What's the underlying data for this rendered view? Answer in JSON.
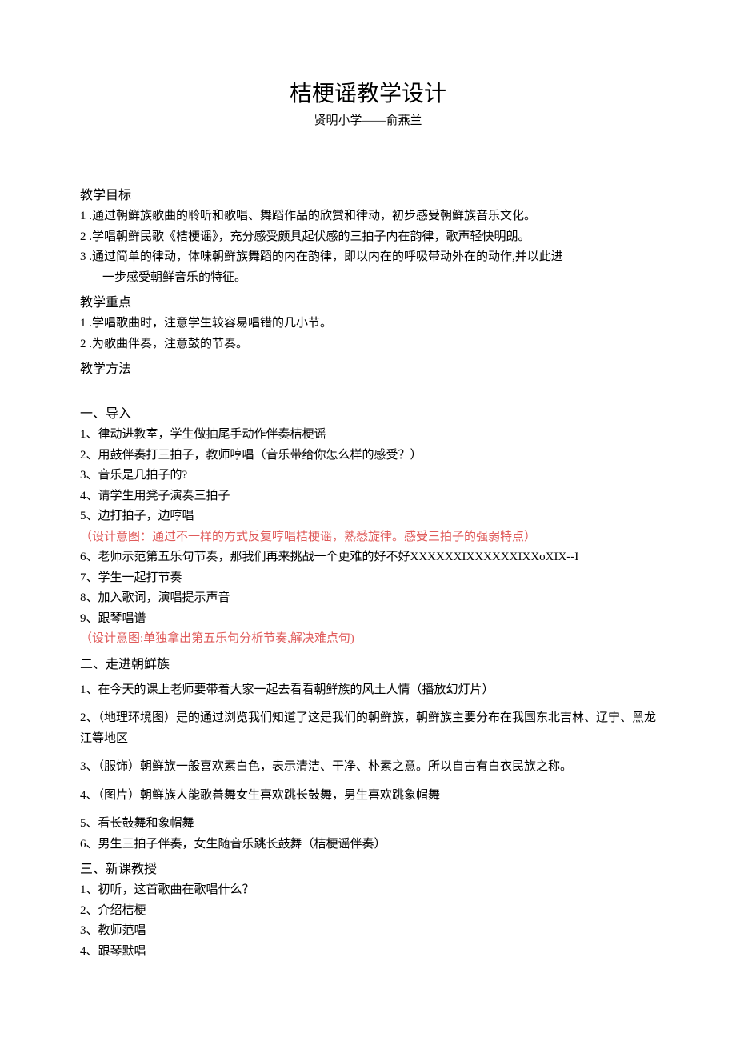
{
  "title": "桔梗谣教学设计",
  "subtitle": "贤明小学——俞燕兰",
  "sections": {
    "goals": {
      "head": "教学目标",
      "items": [
        "1 .通过朝鲜族歌曲的聆听和歌唱、舞蹈作品的欣赏和律动，初步感受朝鲜族音乐文化。",
        "2 .学唱朝鲜民歌《桔梗谣》，充分感受颇具起伏感的三拍子内在韵律，歌声轻快明朗。",
        "3 .通过简单的律动，体味朝鲜族舞蹈的内在韵律，即以内在的呼吸带动外在的动作,并以此进",
        "一步感受朝鲜音乐的特征。"
      ]
    },
    "keypoints": {
      "head": "教学重点",
      "items": [
        "1 .学唱歌曲时，注意学生较容易唱错的几小节。",
        "2 .为歌曲伴奏，注意鼓的节奏。"
      ]
    },
    "method_head": "教学方法",
    "part1": {
      "head": "一、导入",
      "items": [
        "1、律动进教室，学生做抽尾手动作伴奏桔梗谣",
        "2、用鼓伴奏打三拍子，教师哼唱（音乐带给你怎么样的感受？）",
        "3、音乐是几拍子的?",
        "4、请学生用凳子演奏三拍子",
        "5、边打拍子，边哼唱"
      ],
      "note1": "（设计意图：通过不一样的方式反复哼唱桔梗谣，熟悉旋律。感受三拍子的强弱特点）",
      "items2": [
        "6、老师示范第五乐句节奏，那我们再来挑战一个更难的好不好XXXXXXIXXXXXXIXXoXIX--I",
        "7、学生一起打节奏",
        "8、加入歌词，演唱提示声音",
        "9、跟琴唱谱"
      ],
      "note2": "（设计意图:单独拿出第五乐句分析节奏,解决难点句)"
    },
    "part2": {
      "head": "二、走进朝鲜族",
      "paras": [
        "1、在今天的课上老师要带着大家一起去看看朝鲜族的风土人情（播放幻灯片）",
        "2、（地理环境图）是的通过浏览我们知道了这是我们的朝鲜族，朝鲜族主要分布在我国东北吉林、辽宁、黑龙江等地区",
        "3、（服饰）朝鲜族一般喜欢素白色，表示清洁、干净、朴素之意。所以自古有白衣民族之称。",
        "4、（图片）朝鲜族人能歌善舞女生喜欢跳长鼓舞，男生喜欢跳象帽舞"
      ],
      "items": [
        "5、看长鼓舞和象帽舞",
        "6、男生三拍子伴奏，女生随音乐跳长鼓舞（桔梗谣伴奏）"
      ]
    },
    "part3": {
      "head": "三、新课教授",
      "items": [
        "1、初听，这首歌曲在歌唱什么？",
        "2、介绍桔梗",
        "3、教师范唱",
        "4、跟琴默唱"
      ]
    }
  }
}
